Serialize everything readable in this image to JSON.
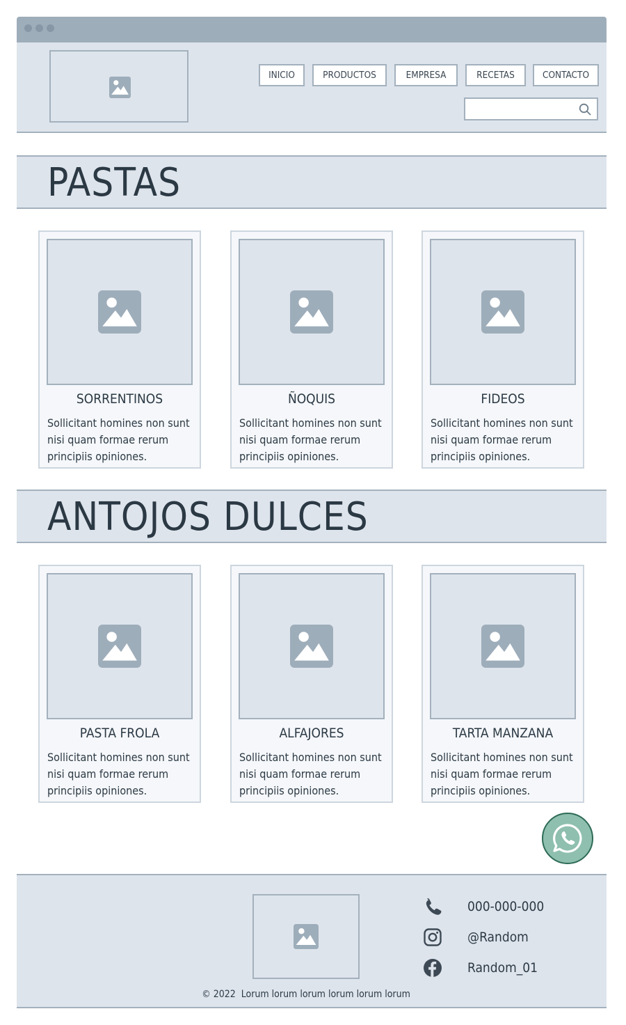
{
  "window": {
    "dots": [
      "dot",
      "dot",
      "dot"
    ]
  },
  "header": {
    "logo_icon": "image-placeholder-icon",
    "nav": [
      "INICIO",
      "PRODUCTOS",
      "EMPRESA",
      "RECETAS",
      "CONTACTO"
    ],
    "search": {
      "placeholder": "",
      "icon": "search-icon"
    }
  },
  "sections": [
    {
      "title": "PASTAS",
      "cards": [
        {
          "title": "SORRENTINOS",
          "desc": "Sollicitant homines non sunt nisi quam formae rerum principiis opiniones."
        },
        {
          "title": "ÑOQUIS",
          "desc": "Sollicitant homines non sunt nisi quam formae rerum principiis opiniones."
        },
        {
          "title": "FIDEOS",
          "desc": "Sollicitant homines non sunt nisi quam formae rerum principiis opiniones."
        }
      ]
    },
    {
      "title": "ANTOJOS DULCES",
      "cards": [
        {
          "title": "PASTA FROLA",
          "desc": "Sollicitant homines non sunt nisi quam formae rerum principiis opiniones."
        },
        {
          "title": "ALFAJORES",
          "desc": "Sollicitant homines non sunt nisi quam formae rerum principiis opiniones."
        },
        {
          "title": "TARTA MANZANA",
          "desc": "Sollicitant homines non sunt nisi quam formae rerum principiis opiniones."
        }
      ]
    }
  ],
  "whatsapp": {
    "icon": "whatsapp-icon",
    "color": "#8fbfae"
  },
  "footer": {
    "logo_icon": "image-placeholder-icon",
    "phone": "000-000-000",
    "instagram": "@Random",
    "facebook": "Random_01",
    "copyright": "© 2022  Lorum lorum lorum lorum lorum lorum"
  },
  "colors": {
    "titlebar": "#9eadba",
    "panel": "#dee4ec",
    "border": "#a3b1bd",
    "text": "#2b3944",
    "icon": "#9eadba"
  }
}
